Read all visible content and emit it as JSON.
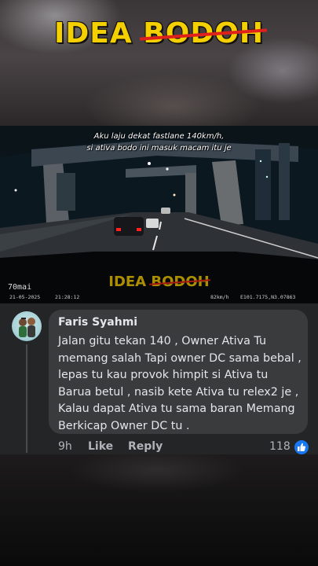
{
  "header": {
    "title_part1": "IDEA ",
    "title_part2": "BODOH"
  },
  "video": {
    "subtitle_line1": "Aku laju dekat fastlane 140km/h,",
    "subtitle_line2": "si ativa bodo ini masuk macam itu je",
    "watermark_part1": "IDEA ",
    "watermark_part2": "BODOH",
    "cam_brand": "70mai",
    "date": "21-05-2025",
    "time": "21:28:12",
    "speed": "82km/h",
    "coords": "E101.7175,N3.07863"
  },
  "comment": {
    "author": "Faris Syahmi",
    "text": "Jalan gitu tekan 140 , Owner Ativa Tu memang salah Tapi owner DC sama bebal , lepas tu kau provok himpit si Ativa tu Barua betul  , nasib kete Ativa tu relex2 je , Kalau dapat Ativa tu sama baran Memang Berkicap Owner DC tu .",
    "time_ago": "9h",
    "like_label": "Like",
    "reply_label": "Reply",
    "reaction_count": "118",
    "reaction_icon": "thumbs-up-icon",
    "reaction_color": "#1877f2"
  }
}
